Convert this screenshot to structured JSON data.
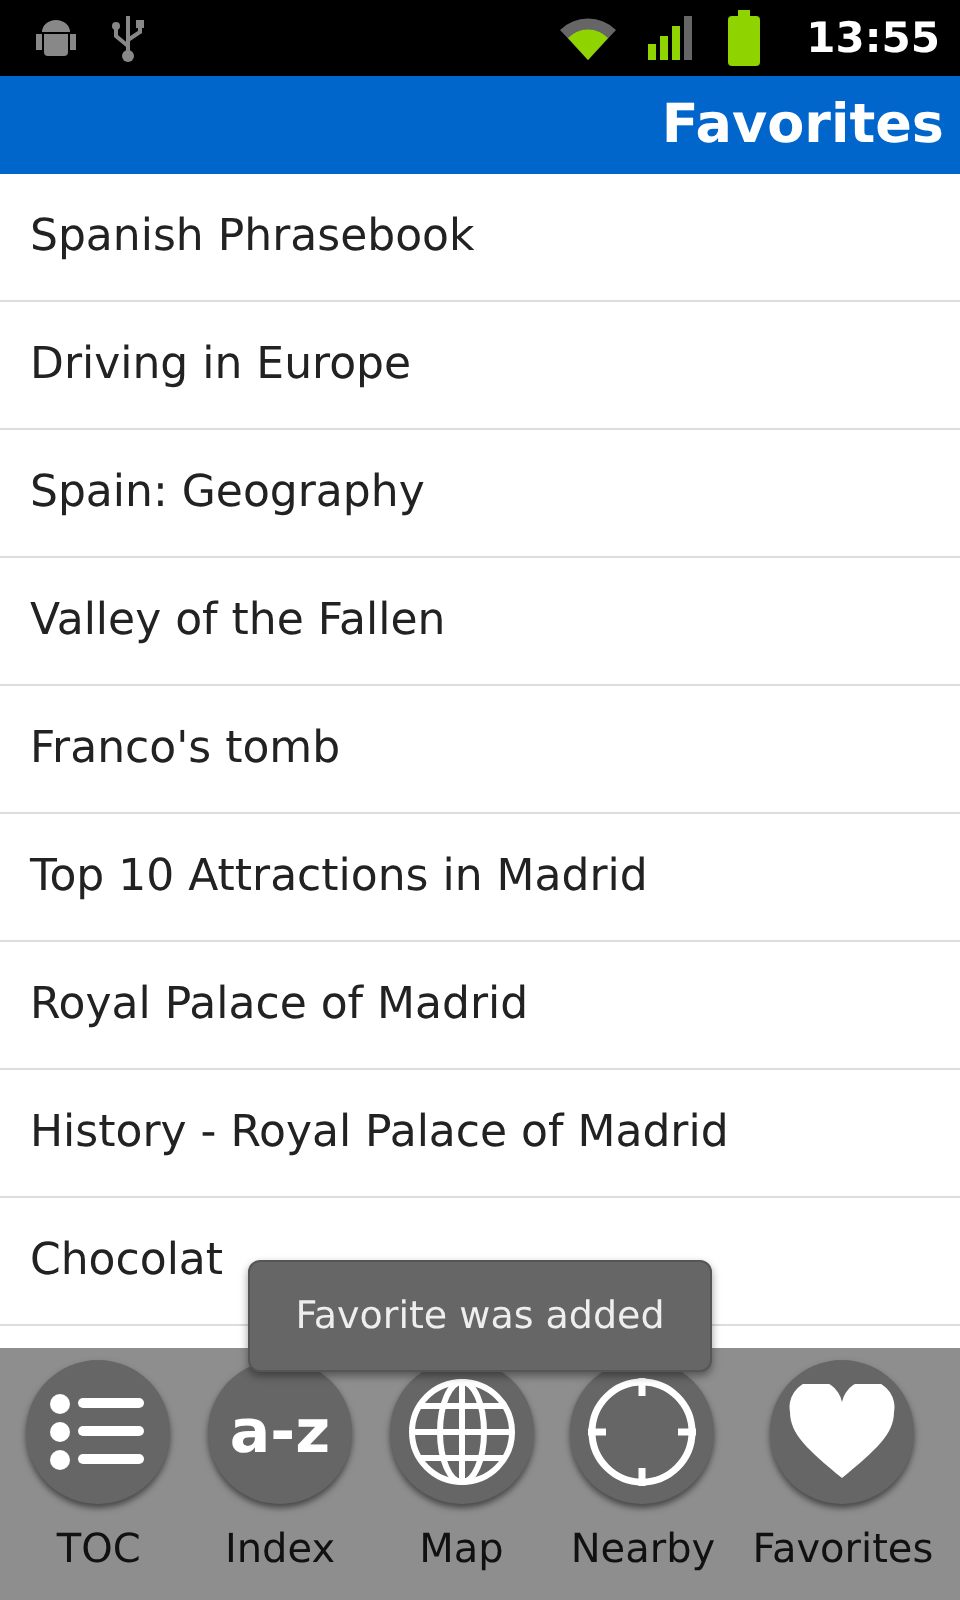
{
  "status_bar": {
    "time": "13:55"
  },
  "title_bar": {
    "title": "Favorites"
  },
  "favorites": [
    "Spanish Phrasebook",
    "Driving in Europe",
    "Spain: Geography",
    "Valley of the Fallen",
    "Franco's tomb",
    "Top 10 Attractions in Madrid",
    "Royal Palace of Madrid",
    "History - Royal Palace of Madrid",
    "Chocolat"
  ],
  "toast": {
    "message": "Favorite was added"
  },
  "bottom_nav": [
    {
      "kind": "toc",
      "label": "TOC"
    },
    {
      "kind": "index",
      "label": "Index",
      "glyph": "a-z"
    },
    {
      "kind": "map",
      "label": "Map"
    },
    {
      "kind": "nearby",
      "label": "Nearby"
    },
    {
      "kind": "favorites",
      "label": "Favorites"
    }
  ]
}
